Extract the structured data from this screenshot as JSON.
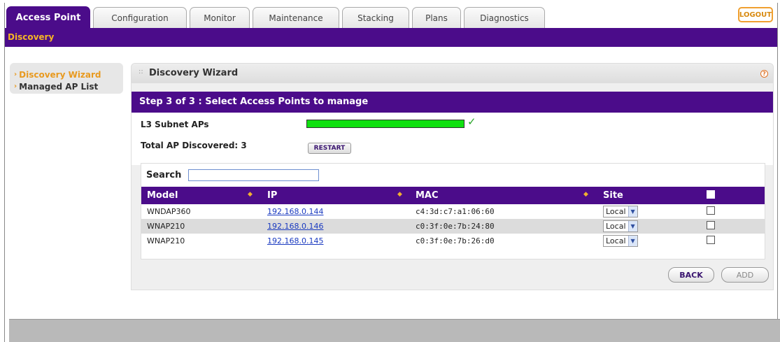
{
  "tabs": [
    {
      "label": "Access Point",
      "active": true
    },
    {
      "label": "Configuration"
    },
    {
      "label": "Monitor"
    },
    {
      "label": "Maintenance"
    },
    {
      "label": "Stacking"
    },
    {
      "label": "Plans"
    },
    {
      "label": "Diagnostics"
    }
  ],
  "logout_label": "LOGOUT",
  "subnav": {
    "label": "Discovery"
  },
  "leftmenu": {
    "items": [
      {
        "label": "Discovery Wizard",
        "active": true
      },
      {
        "label": "Managed AP List"
      }
    ]
  },
  "panel": {
    "title": "Discovery Wizard",
    "help_icon": "?",
    "step_label": "Step 3 of 3 : Select Access Points to manage",
    "subnet_label": "L3 Subnet APs",
    "progress_fraction": 1.0,
    "total_label": "Total AP Discovered: 3",
    "restart_label": "RESTART"
  },
  "search": {
    "label": "Search",
    "value": ""
  },
  "table": {
    "headers": {
      "model": "Model",
      "ip": "IP",
      "mac": "MAC",
      "site": "Site"
    },
    "rows": [
      {
        "model": "WNDAP360",
        "ip": "192.168.0.144",
        "mac": "c4:3d:c7:a1:06:60",
        "site": "Local"
      },
      {
        "model": "WNAP210",
        "ip": "192.168.0.146",
        "mac": "c0:3f:0e:7b:24:80",
        "site": "Local"
      },
      {
        "model": "WNAP210",
        "ip": "192.168.0.145",
        "mac": "c0:3f:0e:7b:26:d0",
        "site": "Local"
      }
    ]
  },
  "buttons": {
    "back": "BACK",
    "add": "ADD"
  },
  "colors": {
    "brand_purple": "#4b0c8a",
    "accent_orange": "#f0b030",
    "progress_green": "#10e010"
  }
}
